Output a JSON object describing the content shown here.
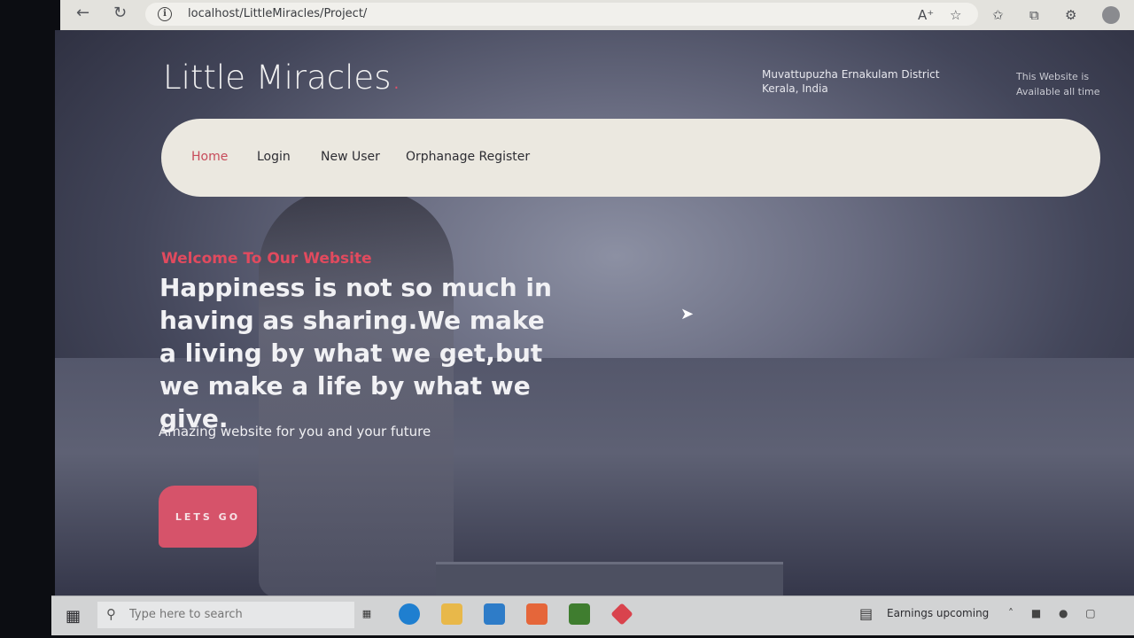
{
  "browser": {
    "url": "localhost/LittleMiracles/Project/",
    "back_icon": "back-arrow-icon",
    "refresh_icon": "refresh-icon",
    "toolbar_icons": [
      "read-aloud-icon",
      "favorite-star-icon",
      "favorites-icon",
      "collections-icon",
      "extensions-icon",
      "profile-icon"
    ]
  },
  "header": {
    "title": "Little Miracles",
    "title_dot": ".",
    "address": "Muvattupuzha Ernakulam District Kerala, India",
    "availability": "This Website is Available all time"
  },
  "nav": {
    "items": [
      {
        "label": "Home",
        "active": true
      },
      {
        "label": "Login",
        "active": false
      },
      {
        "label": "New User",
        "active": false
      },
      {
        "label": "Orphanage Register",
        "active": false
      }
    ]
  },
  "hero": {
    "welcome": "Welcome To Our Website",
    "headline": "Happiness is not so much in having as sharing.We make a living by what we get,but we make a life by what we give.",
    "tagline": "Amazing website for you and your future",
    "cta_label": "LETS GO"
  },
  "taskbar": {
    "search_placeholder": "Type here to search",
    "news_text": "Earnings upcoming",
    "apps": [
      "task-view-icon",
      "edge-icon",
      "file-explorer-icon",
      "mail-icon",
      "xampp-icon",
      "dreamweaver-icon",
      "app-icon"
    ]
  },
  "colors": {
    "accent": "#d6536a",
    "nav_bg": "#ebe8e0"
  }
}
